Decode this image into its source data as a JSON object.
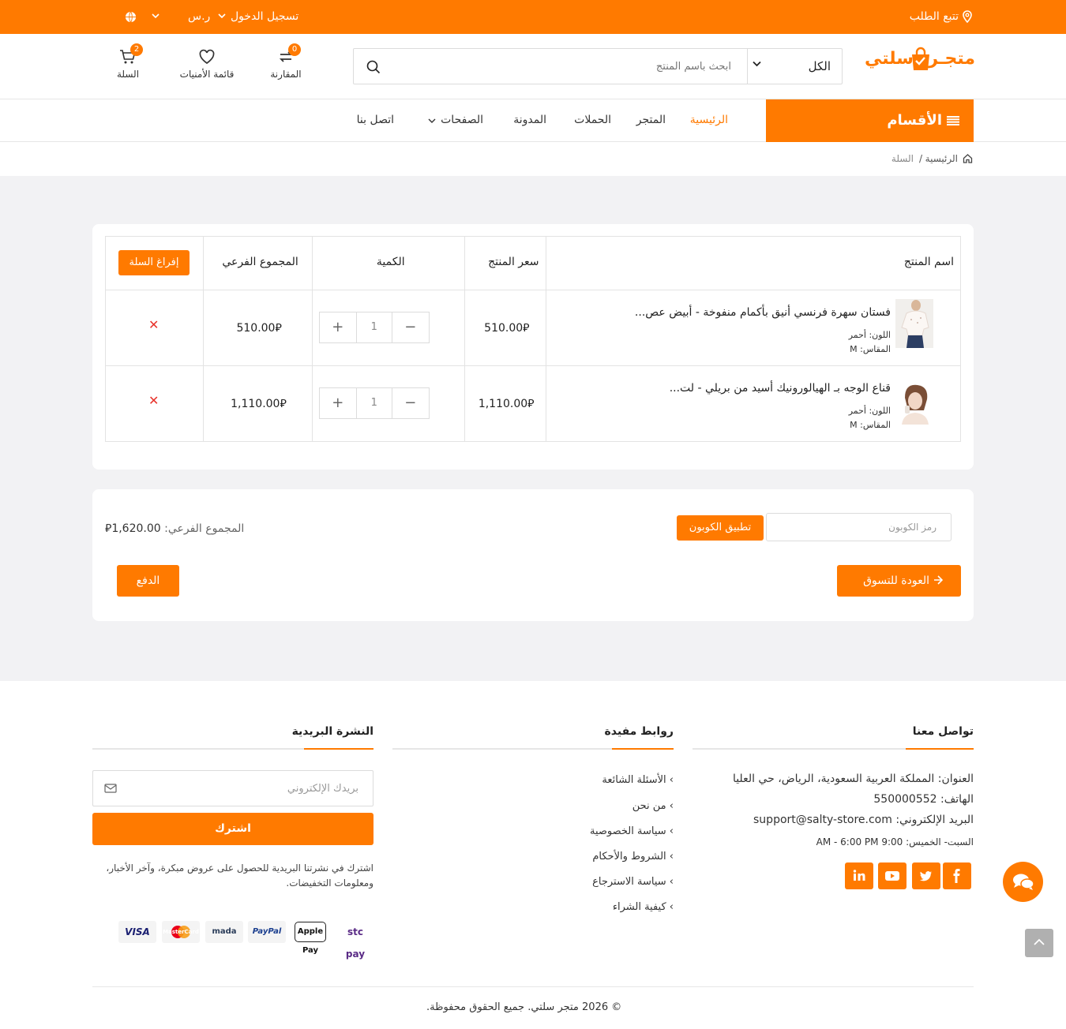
{
  "topbar": {
    "track_order": "تتبع الطلب",
    "login": "تسجيل الدخول",
    "currency": "ر.س"
  },
  "header": {
    "logo_word1": "متجـر",
    "logo_word2": "سلتي",
    "search_category": "الكل",
    "search_placeholder": "ابحث باسم المنتج",
    "compare_label": "المقارنة",
    "compare_count": "0",
    "wishlist_label": "قائمة الأمنيات",
    "cart_label": "السلة",
    "cart_count": "2"
  },
  "nav": {
    "categories": "الأقسام",
    "items": [
      "الرئيسية",
      "المتجر",
      "الحملات",
      "المدونة",
      "الصفحات",
      "اتصل بنا"
    ]
  },
  "breadcrumb": {
    "home": "الرئيسية",
    "sep": "/",
    "current": "السلة"
  },
  "cart": {
    "headers": {
      "name": "اسم المنتج",
      "price": "سعر المنتج",
      "qty": "الكمية",
      "subtotal": "المجموع الفرعي"
    },
    "empty_button": "إفراغ السلة",
    "currency_symbol": "⃁",
    "rows": [
      {
        "name": "فستان سهرة فرنسي أنيق بأكمام منفوخة - أبيض عص...",
        "color": "اللون: أحمر",
        "size": "المقاس: M",
        "price": "510.00",
        "qty": "1",
        "subtotal": "510.00"
      },
      {
        "name": "قناع الوجه بـ الهيالورونيك أسيد من بريلي - لت...",
        "color": "اللون: أحمر",
        "size": "المقاس: M",
        "price": "1,110.00",
        "qty": "1",
        "subtotal": "1,110.00"
      }
    ],
    "remove_glyph": "✕"
  },
  "summary": {
    "coupon_placeholder": "رمز الكوبون",
    "apply_coupon": "تطبيق الكوبون",
    "subtotal_label": "المجموع الفرعي:",
    "subtotal_value": "1,620.00",
    "back_to_shop": "العودة للتسوق",
    "checkout": "الدفع"
  },
  "footer": {
    "contact_title": "تواصل معنا",
    "address": "العنوان: المملكة العربية السعودية، الرياض، حي العليا",
    "phone": "الهاتف: 550000552",
    "email": "البريد الإلكتروني: support@salty-store.com",
    "hours": "السبت- الخميس: 9:00 AM - 6:00 PM",
    "links_title": "روابط مفيدة",
    "links": [
      "الأسئلة الشائعة",
      "من نحن",
      "سياسة الخصوصية",
      "الشروط والأحكام",
      "سياسة الاسترجاع",
      "كيفية الشراء"
    ],
    "newsletter_title": "النشرة البريدية",
    "newsletter_placeholder": "بريدك الإلكتروني",
    "subscribe": "اشترك",
    "newsletter_text_1": "اشترك في نشرتنا البريدية للحصول على عروض مبكرة، وآخر الأخبار،",
    "newsletter_text_2": "ومعلومات التخفيضات.",
    "payments": [
      "stc pay",
      "Apple Pay",
      "PayPal",
      "mada",
      "MasterCard",
      "VISA"
    ],
    "social": [
      "f",
      "t",
      "yt",
      "in"
    ],
    "copyright": "© 2026 متجر سلتي. جميع الحقوق محفوظة."
  },
  "colors": {
    "accent": "#ff7a00",
    "remove": "#e8332b"
  }
}
